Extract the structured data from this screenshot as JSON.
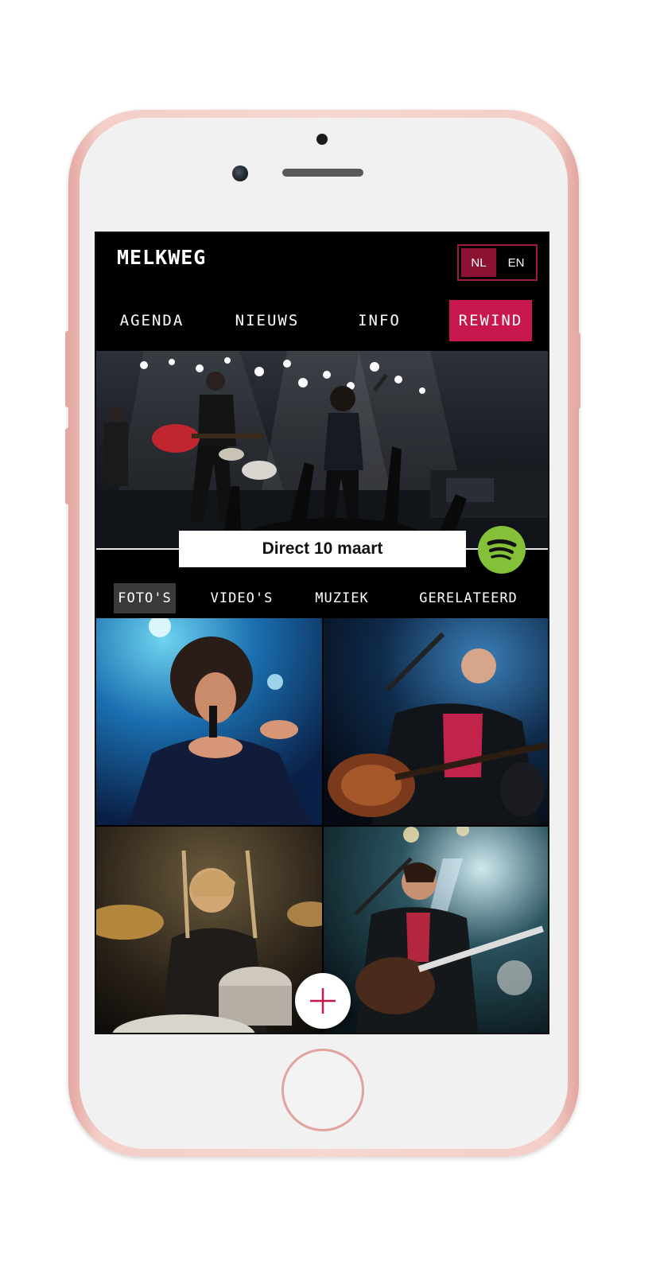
{
  "app": {
    "logo": "MELKWEG"
  },
  "language": {
    "options": [
      {
        "label": "NL",
        "active": true
      },
      {
        "label": "EN",
        "active": false
      }
    ],
    "active_color": "#8d1234",
    "border_color": "#a01c3e"
  },
  "nav": {
    "items": [
      {
        "label": "AGENDA",
        "active": false
      },
      {
        "label": "NIEUWS",
        "active": false
      },
      {
        "label": "INFO",
        "active": false
      },
      {
        "label": "REWIND",
        "active": true
      }
    ],
    "active_color": "#c8174d"
  },
  "event": {
    "date_label": "Direct 10 maart"
  },
  "spotify": {
    "icon": "spotify-icon",
    "color": "#84c138"
  },
  "tabs": {
    "items": [
      {
        "label": "FOTO'S",
        "active": true
      },
      {
        "label": "VIDEO'S",
        "active": false
      },
      {
        "label": "MUZIEK",
        "active": false
      },
      {
        "label": "GERELATEERD",
        "active": false
      }
    ]
  },
  "fab": {
    "icon": "plus-icon",
    "color": "#c8174d"
  }
}
